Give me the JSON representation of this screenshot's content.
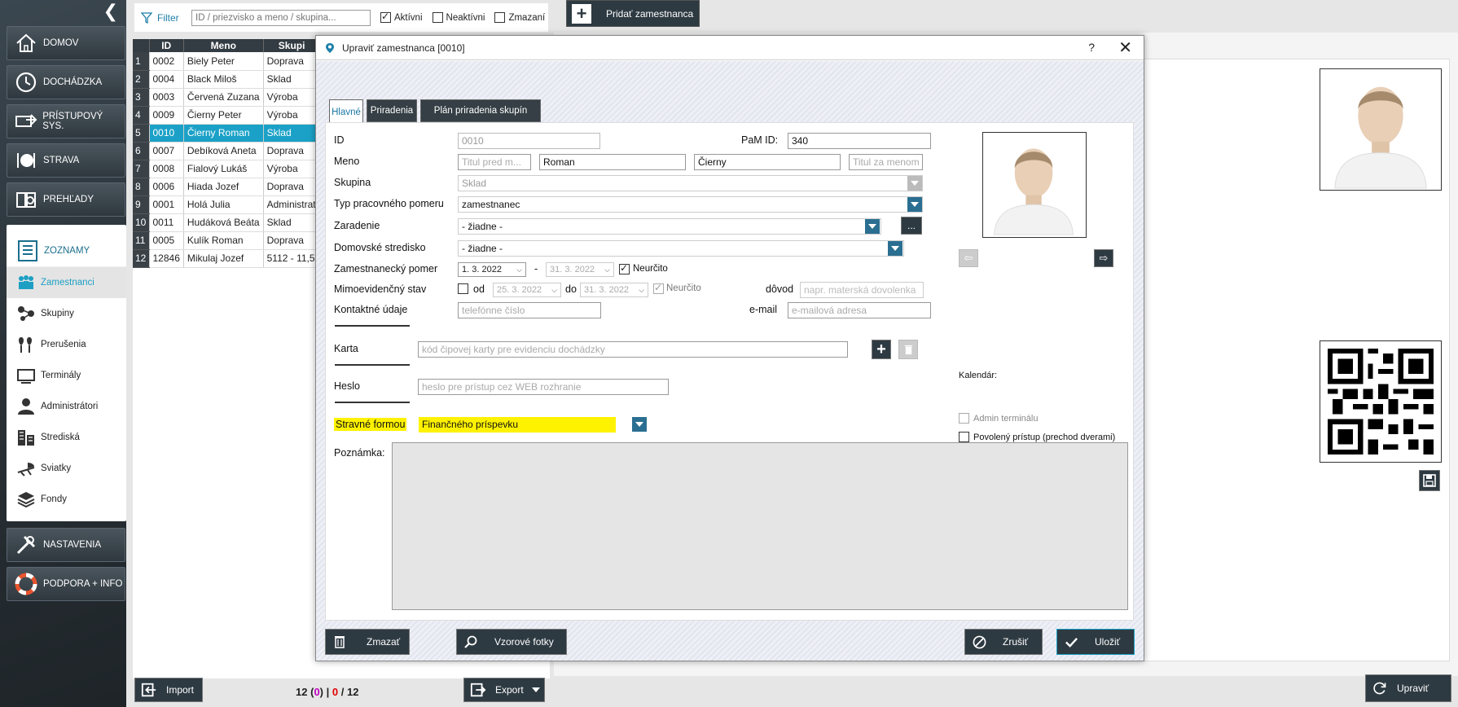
{
  "sidebar": {
    "main_items": [
      {
        "label": "DOMOV",
        "icon": "home-icon"
      },
      {
        "label": "DOCHÁDZKA",
        "icon": "clock-icon"
      },
      {
        "label": "PRÍSTUPOVÝ SYS.",
        "icon": "access-card-icon"
      },
      {
        "label": "STRAVA",
        "icon": "plate-icon"
      },
      {
        "label": "PREHĽADY",
        "icon": "report-icon"
      }
    ],
    "zoznamy": {
      "label": "ZOZNAMY",
      "items": [
        {
          "label": "Zamestnanci",
          "icon": "people-icon",
          "active": true
        },
        {
          "label": "Skupiny",
          "icon": "groups-icon"
        },
        {
          "label": "Prerušenia",
          "icon": "interruption-icon"
        },
        {
          "label": "Terminály",
          "icon": "terminal-icon"
        },
        {
          "label": "Administrátori",
          "icon": "admin-icon"
        },
        {
          "label": "Strediská",
          "icon": "building-icon"
        },
        {
          "label": "Sviatky",
          "icon": "holiday-icon"
        },
        {
          "label": "Fondy",
          "icon": "layers-icon"
        }
      ]
    },
    "bottom_items": [
      {
        "label": "NASTAVENIA",
        "icon": "tools-icon"
      },
      {
        "label": "PODPORA + INFO",
        "icon": "lifebuoy-icon"
      }
    ]
  },
  "filterbar": {
    "label": "Filter",
    "search_placeholder": "ID / priezvisko a meno / skupina...",
    "checkboxes": [
      {
        "label": "Aktívni",
        "checked": true
      },
      {
        "label": "Neaktívni",
        "checked": false
      },
      {
        "label": "Zmazaní",
        "checked": false
      }
    ]
  },
  "add_employee_label": "Pridať zamestnanca",
  "table": {
    "headers": [
      "ID",
      "Meno",
      "Skupi"
    ],
    "rows": [
      {
        "n": "1",
        "id": "0002",
        "name": "Biely Peter",
        "group": "Doprava"
      },
      {
        "n": "2",
        "id": "0004",
        "name": "Black Miloš",
        "group": "Sklad"
      },
      {
        "n": "3",
        "id": "0003",
        "name": "Červená Zuzana",
        "group": "Výroba"
      },
      {
        "n": "4",
        "id": "0009",
        "name": "Čierny Peter",
        "group": "Výroba"
      },
      {
        "n": "5",
        "id": "0010",
        "name": "Čierny Roman",
        "group": "Sklad",
        "selected": true
      },
      {
        "n": "6",
        "id": "0007",
        "name": "Debíková Aneta",
        "group": "Doprava"
      },
      {
        "n": "7",
        "id": "0008",
        "name": "Fialový Lukáš",
        "group": "Výroba"
      },
      {
        "n": "8",
        "id": "0006",
        "name": "Hiada Jozef",
        "group": "Doprava"
      },
      {
        "n": "9",
        "id": "0001",
        "name": "Holá Julia",
        "group": "Administrat"
      },
      {
        "n": "10",
        "id": "0011",
        "name": "Hudáková Beáta",
        "group": "Sklad"
      },
      {
        "n": "11",
        "id": "0005",
        "name": "Kulík Roman",
        "group": "Doprava"
      },
      {
        "n": "12",
        "id": "12846",
        "name": "Mikulaj Jozef",
        "group": "5112 - 11,5"
      }
    ]
  },
  "bottombar": {
    "import_label": "Import",
    "export_label": "Export",
    "count_total": "12",
    "count_open": "(",
    "count_magenta": "0",
    "count_close": ")",
    "count_sep1": "|",
    "count_red": "0",
    "count_sep2": "/",
    "count_all": "12"
  },
  "upravit_label": "Upraviť",
  "modal": {
    "title": "Upraviť zamestnanca [0010]",
    "help": "?",
    "close": "✕",
    "tabs": [
      "Hlavné",
      "Priradenia",
      "Plán priradenia skupín"
    ],
    "labels": {
      "id": "ID",
      "meno": "Meno",
      "skupina": "Skupina",
      "typ": "Typ pracovného pomeru",
      "zaradenie": "Zaradenie",
      "stredisko": "Domovské stredisko",
      "pomer": "Zamestnanecký pomer",
      "mimo": "Mimoevidenčný stav",
      "kontakt": "Kontaktné údaje",
      "pam": "PaM ID:",
      "email": "e-mail",
      "dovod": "dôvod",
      "od": "od",
      "do": "do",
      "dash": "-",
      "karta": "Karta",
      "heslo": "Heslo",
      "strava": "Stravné formou",
      "poznamka": "Poznámka:",
      "kalendar": "Kalendár:",
      "admin_terminal": "Admin terminálu",
      "povoleny": "Povolený prístup (prechod dverami)",
      "neurcito": "Neurčito",
      "neurcito2": "Neurčito"
    },
    "values": {
      "id": "0010",
      "pam": "340",
      "titul_pred_ph": "Titul pred m...",
      "first_name": "Roman",
      "last_name": "Čierny",
      "titul_za_ph": "Titul za menom",
      "skupina": "Sklad",
      "typ": "zamestnanec",
      "zaradenie": "- žiadne -",
      "zaradenie_more": "...",
      "stredisko": "- žiadne -",
      "pomer_od": "1. 3. 2022",
      "pomer_do": "31. 3. 2022",
      "mimo_od": "25. 3. 2022",
      "mimo_do": "31. 3. 2022",
      "dovod_ph": "napr. materská dovolenka",
      "phone_ph": "telefónne číslo",
      "email_ph": "e-mailová adresa",
      "karta_ph": "kód čipovej karty pre evidenciu dochádzky",
      "heslo_ph": "heslo pre prístup cez WEB rozhranie",
      "strava": "Finančného príspevku"
    },
    "buttons": {
      "zmazat": "Zmazať",
      "fotky": "Vzorové fotky",
      "zrusit": "Zrušiť",
      "ulozit": "Uložiť"
    }
  },
  "colors": {
    "accent": "#1ba1c7",
    "dark": "#2e3a42",
    "highlight": "#fff200",
    "dropdown": "#2a6f91"
  }
}
